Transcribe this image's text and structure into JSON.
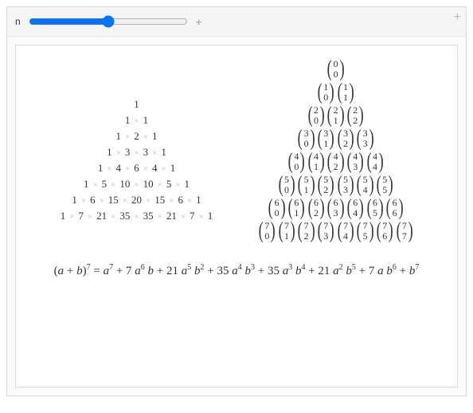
{
  "control": {
    "n_label": "n",
    "n_value": 7,
    "expand_icon": "+",
    "slider_expand": "+"
  },
  "pascal_numeric": {
    "times_symbol": "×",
    "rows": [
      [
        1
      ],
      [
        1,
        1
      ],
      [
        1,
        2,
        1
      ],
      [
        1,
        3,
        3,
        1
      ],
      [
        1,
        4,
        6,
        4,
        1
      ],
      [
        1,
        5,
        10,
        10,
        5,
        1
      ],
      [
        1,
        6,
        15,
        20,
        15,
        6,
        1
      ],
      [
        1,
        7,
        21,
        35,
        35,
        21,
        7,
        1
      ]
    ]
  },
  "pascal_binom": {
    "rows": [
      [
        [
          0,
          0
        ]
      ],
      [
        [
          1,
          0
        ],
        [
          1,
          1
        ]
      ],
      [
        [
          2,
          0
        ],
        [
          2,
          1
        ],
        [
          2,
          2
        ]
      ],
      [
        [
          3,
          0
        ],
        [
          3,
          1
        ],
        [
          3,
          2
        ],
        [
          3,
          3
        ]
      ],
      [
        [
          4,
          0
        ],
        [
          4,
          1
        ],
        [
          4,
          2
        ],
        [
          4,
          3
        ],
        [
          4,
          4
        ]
      ],
      [
        [
          5,
          0
        ],
        [
          5,
          1
        ],
        [
          5,
          2
        ],
        [
          5,
          3
        ],
        [
          5,
          4
        ],
        [
          5,
          5
        ]
      ],
      [
        [
          6,
          0
        ],
        [
          6,
          1
        ],
        [
          6,
          2
        ],
        [
          6,
          3
        ],
        [
          6,
          4
        ],
        [
          6,
          5
        ],
        [
          6,
          6
        ]
      ],
      [
        [
          7,
          0
        ],
        [
          7,
          1
        ],
        [
          7,
          2
        ],
        [
          7,
          3
        ],
        [
          7,
          4
        ],
        [
          7,
          5
        ],
        [
          7,
          6
        ],
        [
          7,
          7
        ]
      ]
    ]
  },
  "equation": {
    "lhs_base": "(a + b)",
    "lhs_exp": "7",
    "eq": " = ",
    "terms": [
      {
        "coef": "",
        "a_exp": "7",
        "b_exp": ""
      },
      {
        "coef": "7",
        "a_exp": "6",
        "b_exp": "1"
      },
      {
        "coef": "21",
        "a_exp": "5",
        "b_exp": "2"
      },
      {
        "coef": "35",
        "a_exp": "4",
        "b_exp": "3"
      },
      {
        "coef": "35",
        "a_exp": "3",
        "b_exp": "4"
      },
      {
        "coef": "21",
        "a_exp": "2",
        "b_exp": "5"
      },
      {
        "coef": "7",
        "a_exp": "1",
        "b_exp": "6"
      },
      {
        "coef": "",
        "a_exp": "",
        "b_exp": "7"
      }
    ],
    "rendered": "a⁷ + 7 a⁶ b + 21 a⁵ b² + 35 a⁴ b³ + 35 a³ b⁴ + 21 a² b⁵ + 7 a b⁶ + b⁷"
  }
}
